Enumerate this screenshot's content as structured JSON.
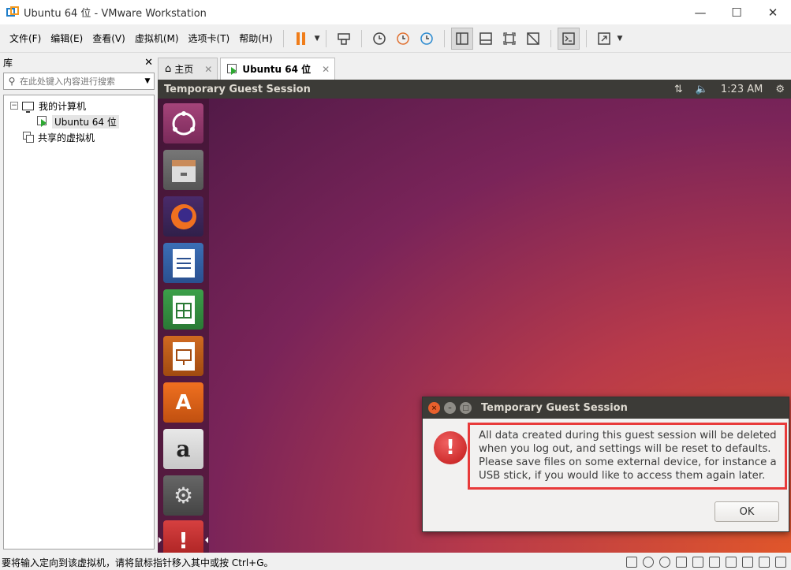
{
  "window": {
    "title": "Ubuntu 64 位 - VMware Workstation"
  },
  "menu": [
    "文件(F)",
    "编辑(E)",
    "查看(V)",
    "虚拟机(M)",
    "选项卡(T)",
    "帮助(H)"
  ],
  "library": {
    "title": "库",
    "search_placeholder": "在此处键入内容进行搜索",
    "tree": {
      "root": "我的计算机",
      "vm": "Ubuntu 64 位",
      "shared": "共享的虚拟机"
    }
  },
  "tabs": [
    {
      "label": "主页",
      "active": false
    },
    {
      "label": "Ubuntu 64 位",
      "active": true
    }
  ],
  "guest": {
    "session_title": "Temporary Guest Session",
    "clock": "1:23 AM",
    "launcher": [
      "ubuntu-dash-icon",
      "files-icon",
      "firefox-icon",
      "writer-icon",
      "calc-icon",
      "impress-icon",
      "software-icon",
      "amazon-icon",
      "settings-icon",
      "alert-icon"
    ]
  },
  "dialog": {
    "title": "Temporary Guest Session",
    "message": "All data created during this guest session will be deleted when you log out, and settings will be reset to defaults. Please save files on some external device, for instance a USB stick, if you would like to access them again later.",
    "ok_label": "OK"
  },
  "status": {
    "message": "要将输入定向到该虚拟机，请将鼠标指针移入其中或按 Ctrl+G。"
  },
  "colors": {
    "highlight": "#e83a3a",
    "pause": "#f07d1a",
    "ubuntu_title": "#3c3b37"
  }
}
